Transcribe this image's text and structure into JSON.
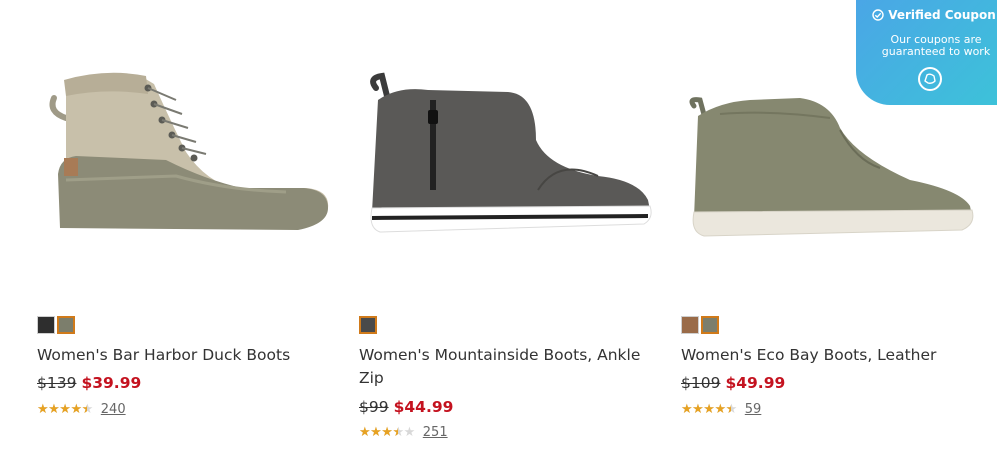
{
  "products": [
    {
      "image_icon": "duck-boot-image",
      "swatches": [
        {
          "color": "#2e2e2e",
          "selected": false
        },
        {
          "color": "#7c7e6c",
          "selected": true
        }
      ],
      "name": "Women's Bar Harbor Duck Boots",
      "was_price": "$139",
      "sale_price": "$39.99",
      "rating": 4.5,
      "review_count": "240"
    },
    {
      "image_icon": "ankle-zip-boot-image",
      "swatches": [
        {
          "color": "#4a4a4a",
          "selected": true
        }
      ],
      "name": "Women's Mountainside Boots, Ankle Zip",
      "was_price": "$99",
      "sale_price": "$44.99",
      "rating": 3.5,
      "review_count": "251"
    },
    {
      "image_icon": "leather-boot-image",
      "swatches": [
        {
          "color": "#9a6b48",
          "selected": false
        },
        {
          "color": "#7c7e6c",
          "selected": true
        }
      ],
      "name": "Women's Eco Bay Boots, Leather",
      "was_price": "$109",
      "sale_price": "$49.99",
      "rating": 4.5,
      "review_count": "59"
    }
  ],
  "coupon": {
    "title": "Verified Coupon",
    "subtitle": "Our coupons are guaranteed to work",
    "icon": "coupon-chat-icon"
  },
  "colors": {
    "sale_price": "#c4121f",
    "star_fill": "#e7a222",
    "coupon_gradient_start": "#4aa6e6",
    "coupon_gradient_end": "#3cc4d8"
  }
}
